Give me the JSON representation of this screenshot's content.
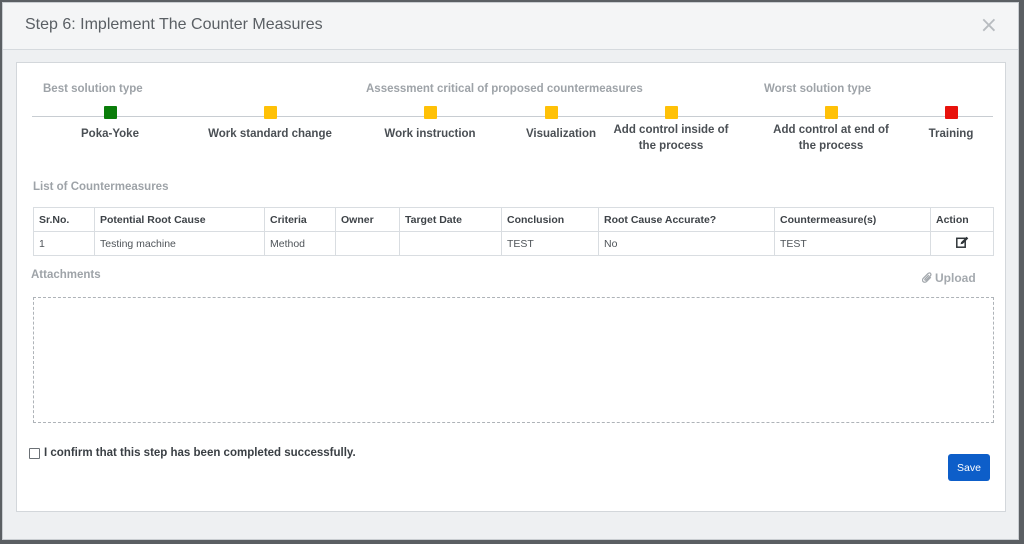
{
  "modal": {
    "title": "Step 6: Implement The Counter Measures",
    "close": "×"
  },
  "scale": {
    "best_label": "Best solution type",
    "assessment_label": "Assessment critical of proposed countermeasures",
    "worst_label": "Worst solution type",
    "colors": {
      "green": "#0a7d0a",
      "yellow": "#ffc107",
      "red": "#e8120c"
    },
    "items": [
      {
        "label": "Poka-Yoke",
        "color": "#0a7d0a"
      },
      {
        "label": "Work standard change",
        "color": "#ffc107"
      },
      {
        "label": "Work instruction",
        "color": "#ffc107"
      },
      {
        "label": "Visualization",
        "color": "#ffc107"
      },
      {
        "label": "Add control inside of the process",
        "color": "#ffc107"
      },
      {
        "label": "Add control at end of the process",
        "color": "#ffc107"
      },
      {
        "label": "Training",
        "color": "#e8120c"
      }
    ]
  },
  "countermeasures": {
    "title": "List of Countermeasures",
    "headers": [
      "Sr.No.",
      "Potential Root Cause",
      "Criteria",
      "Owner",
      "Target Date",
      "Conclusion",
      "Root Cause Accurate?",
      "Countermeasure(s)",
      "Action"
    ],
    "rows": [
      [
        "1",
        "Testing machine",
        "Method",
        "",
        "",
        "TEST",
        "No",
        "TEST"
      ]
    ]
  },
  "attachments": {
    "title": "Attachments",
    "upload_label": "Upload"
  },
  "confirm": {
    "label": "I confirm that this step has been completed successfully."
  },
  "save": {
    "label": "Save",
    "color": "#0d5ec9"
  }
}
